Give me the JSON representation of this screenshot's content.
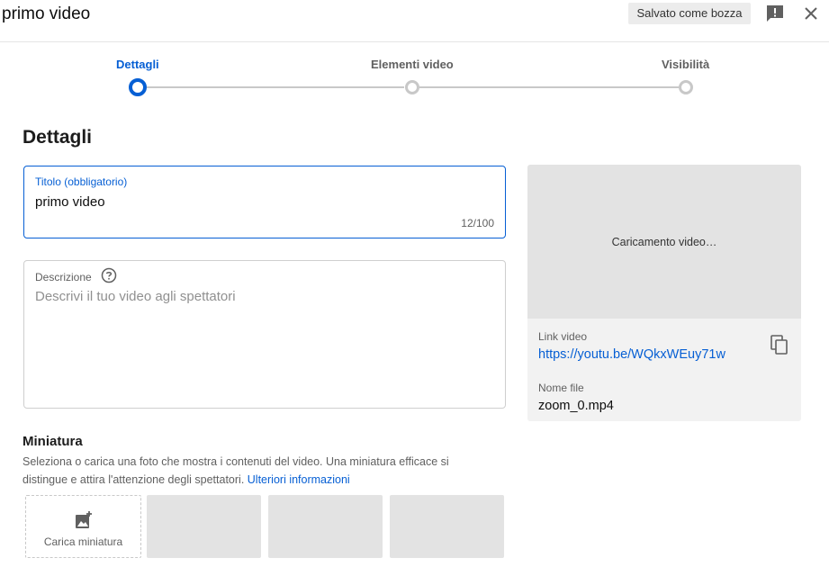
{
  "header": {
    "title": "primo video",
    "draft_status": "Salvato come bozza",
    "feedback_icon": "feedback-icon",
    "close_icon": "close-icon"
  },
  "stepper": {
    "steps": [
      {
        "label": "Dettagli",
        "active": true
      },
      {
        "label": "Elementi video",
        "active": false
      },
      {
        "label": "Visibilità",
        "active": false
      }
    ]
  },
  "section_title": "Dettagli",
  "title_field": {
    "label": "Titolo (obbligatorio)",
    "value": "primo video",
    "counter": "12/100"
  },
  "description_field": {
    "label": "Descrizione",
    "placeholder": "Descrivi il tuo video agli spettatori",
    "help_icon": "help-icon"
  },
  "preview": {
    "status": "Caricamento video…",
    "link_label": "Link video",
    "link": "https://youtu.be/WQkxWEuy71w",
    "copy_icon": "copy-icon",
    "file_label": "Nome file",
    "file_name": "zoom_0.mp4"
  },
  "thumbnail": {
    "title": "Miniatura",
    "description": "Seleziona o carica una foto che mostra i contenuti del video. Una miniatura efficace si distingue e attira l'attenzione degli spettatori.",
    "learn_more": "Ulteriori informazioni",
    "upload_label": "Carica miniatura",
    "upload_icon": "add-photo-icon"
  },
  "colors": {
    "accent": "#065fd4",
    "inactive": "#c8c8c8",
    "placeholder_bg": "#e3e3e3"
  }
}
